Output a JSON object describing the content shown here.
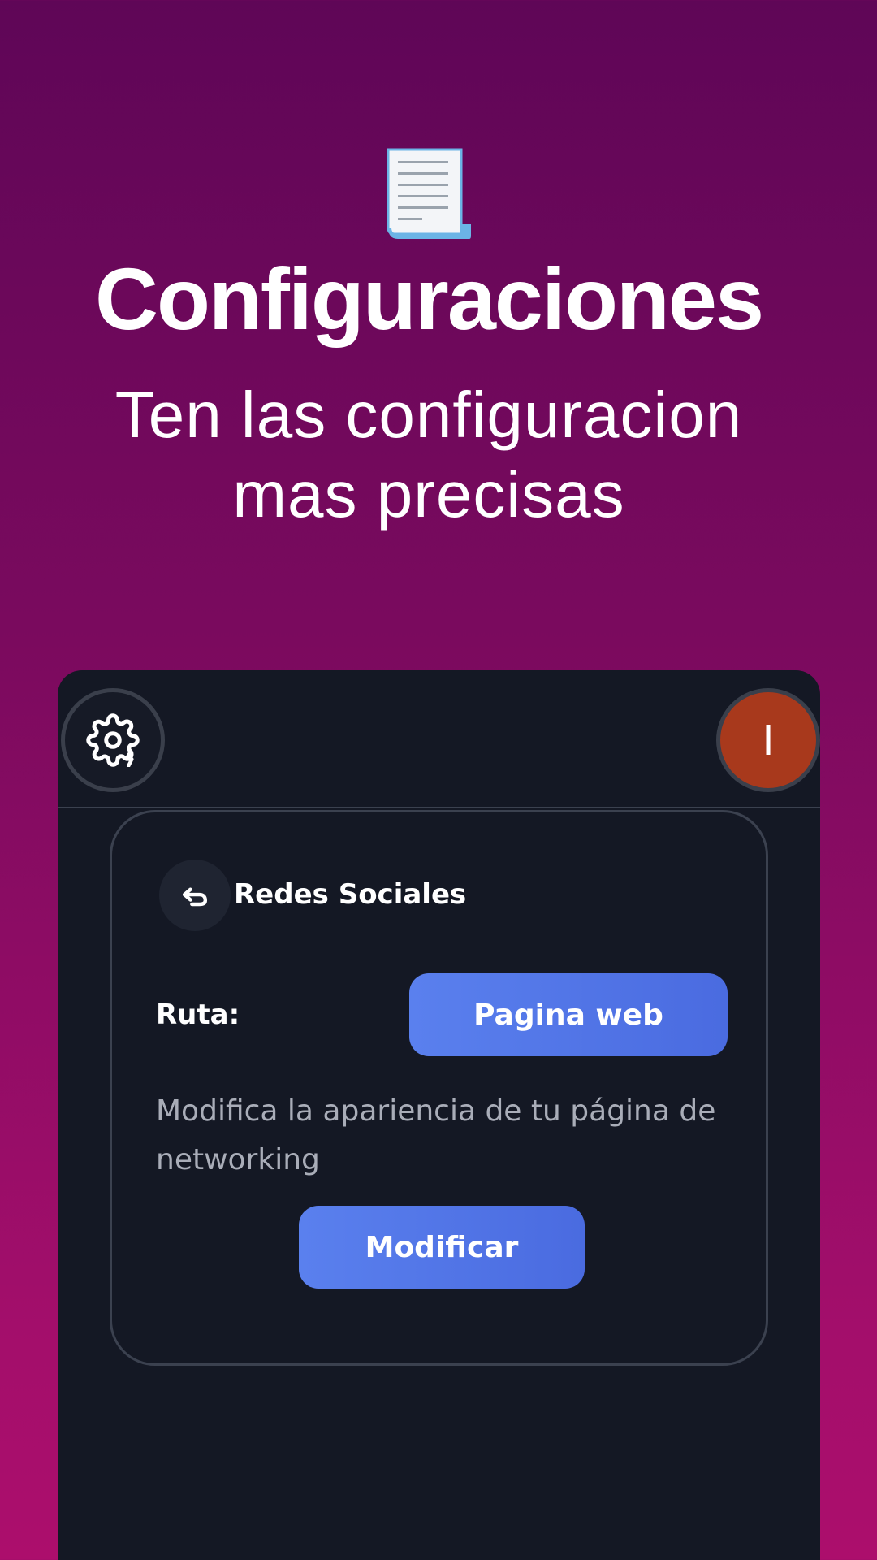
{
  "hero": {
    "icon": "page-document-icon",
    "title": "Configuraciones",
    "subtitle_line1": "Ten las configuracion",
    "subtitle_line2": "mas precisas"
  },
  "topbar": {
    "settings_icon": "gear-bolt-icon",
    "avatar_initial": "I"
  },
  "card": {
    "back_icon": "return-arrow-icon",
    "title": "Redes Sociales",
    "route_label": "Ruta:",
    "route_button": "Pagina web",
    "description": "Modifica la apariencia de tu página de networking",
    "modify_button": "Modificar"
  },
  "colors": {
    "background_top": "#5f0657",
    "background_bottom": "#ac0e6c",
    "phone_bg": "#141824",
    "accent_blue": "#5277e8",
    "avatar_bg": "#a8391c"
  }
}
